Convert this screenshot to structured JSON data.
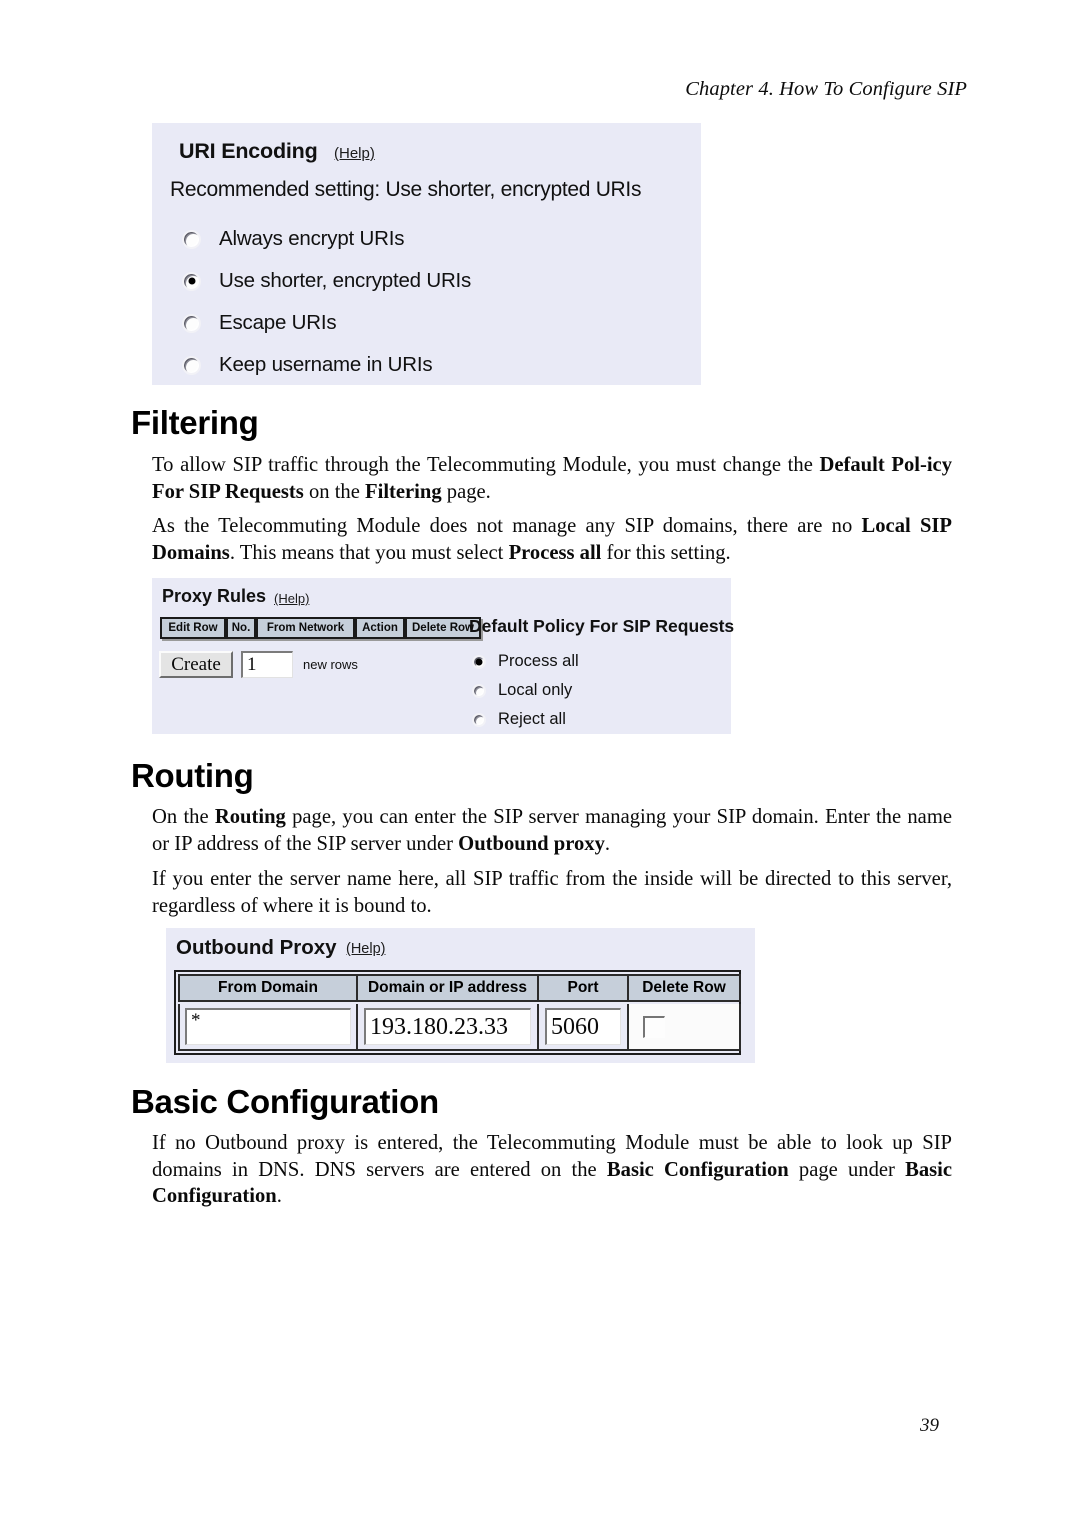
{
  "page": {
    "running_head": "Chapter 4. How To Configure SIP",
    "number": "39"
  },
  "uri_encoding_panel": {
    "title": "URI Encoding",
    "help_label": "(Help)",
    "recommendation": "Recommended setting: Use shorter, encrypted URIs",
    "options": [
      {
        "label": "Always encrypt URIs",
        "selected": false
      },
      {
        "label": "Use shorter, encrypted URIs",
        "selected": true
      },
      {
        "label": "Escape URIs",
        "selected": false
      },
      {
        "label": "Keep username in URIs",
        "selected": false
      }
    ]
  },
  "filtering_section": {
    "heading": "Filtering",
    "paragraph_1": {
      "part_1": "To allow SIP traffic through the Telecommuting Module, you must change the ",
      "bold_1": "Default Pol-",
      "bold_2": "icy For SIP Requests",
      "part_2": " on the ",
      "bold_3": "Filtering",
      "part_3": " page."
    },
    "paragraph_2": {
      "part_1": "As the Telecommuting Module does not manage any SIP domains, there are no ",
      "bold_1": "Local SIP",
      "bold_2": "Domains",
      "part_2": ". This means that you must select ",
      "bold_3": "Process all",
      "part_3": " for this setting."
    }
  },
  "proxy_rules_panel": {
    "title": "Proxy Rules",
    "help_label": "(Help)",
    "column_headers": [
      "Edit Row",
      "No.",
      "From Network",
      "Action",
      "Delete Row"
    ],
    "create_button_label": "Create",
    "rows_value": "1",
    "rows_suffix": "new rows",
    "policy_title": "Default Policy For SIP Requests",
    "policy_options": [
      {
        "label": "Process all",
        "selected": true
      },
      {
        "label": "Local only",
        "selected": false
      },
      {
        "label": "Reject all",
        "selected": false
      }
    ]
  },
  "routing_section": {
    "heading": "Routing",
    "paragraph_1": {
      "part_1": "On the ",
      "bold_1": "Routing",
      "part_2": " page, you can enter the SIP server managing your SIP domain. Enter the name or IP address of the SIP server under ",
      "bold_2": "Outbound proxy",
      "part_3": "."
    },
    "paragraph_2": "If you enter the server name here, all SIP traffic from the inside will be directed to this server, regardless of where it is bound to."
  },
  "outbound_proxy_panel": {
    "title": "Outbound Proxy",
    "help_label": "(Help)",
    "column_headers": [
      "From Domain",
      "Domain or IP address",
      "Port",
      "Delete Row"
    ],
    "row": {
      "from_domain": "*",
      "domain_or_ip": "193.180.23.33",
      "port": "5060",
      "delete_checked": false
    }
  },
  "basic_configuration_section": {
    "heading": "Basic Configuration",
    "paragraph_1": {
      "part_1": "If no Outbound proxy is entered, the Telecommuting Module must be able to look up SIP domains in DNS. DNS servers are entered on the ",
      "bold_1": "Basic Configuration",
      "part_2": " page under ",
      "bold_2": "Basic",
      "bold_3": "Configuration",
      "part_3": "."
    }
  },
  "colors": {
    "panel_background": "#e9eaf6",
    "table_header": "#c6cfda",
    "text": "#000000"
  }
}
